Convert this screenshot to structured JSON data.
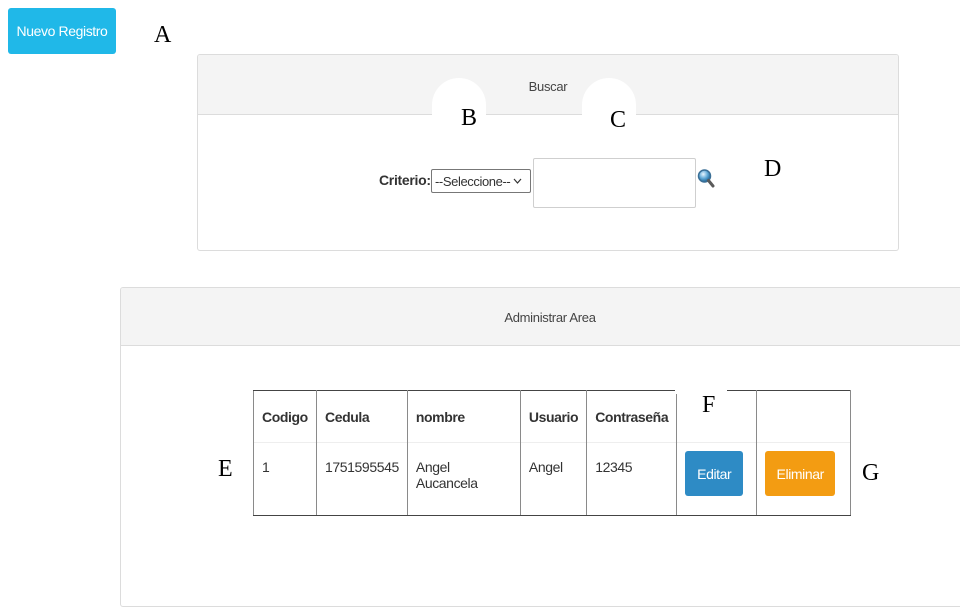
{
  "toolbar": {
    "nuevo_label": "Nuevo Registro"
  },
  "buscar_panel": {
    "title": "Buscar",
    "criterio_label": "Criterio:",
    "select_value": "--Seleccione--",
    "search_value": ""
  },
  "admin_panel": {
    "title": "Administrar Area",
    "columns": [
      "Codigo",
      "Cedula",
      "nombre",
      "Usuario",
      "Contraseña",
      "",
      ""
    ],
    "rows": [
      {
        "codigo": "1",
        "cedula": "1751595545",
        "nombre": "Angel Aucancela",
        "usuario": "Angel",
        "contrasena": "12345",
        "editar_label": "Editar",
        "eliminar_label": "Eliminar"
      }
    ]
  },
  "annotations": {
    "a": "A",
    "b": "B",
    "c": "C",
    "d": "D",
    "e": "E",
    "f": "F",
    "g": "G"
  },
  "colors": {
    "primary_info": "#20b8e8",
    "edit": "#2e8bc5",
    "delete": "#f39c12"
  },
  "icons": {
    "search": "search-icon",
    "select_arrow": "chevron-down-icon"
  }
}
